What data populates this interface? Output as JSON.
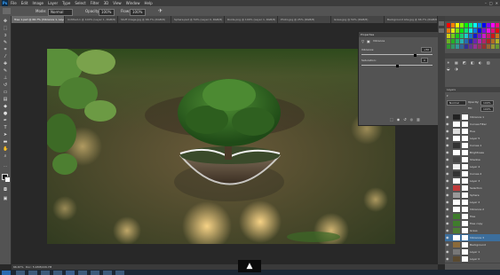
{
  "app": {
    "logo": "Ps"
  },
  "menu": [
    "File",
    "Edit",
    "Image",
    "Layer",
    "Type",
    "Select",
    "Filter",
    "3D",
    "View",
    "Window",
    "Help"
  ],
  "window_controls": [
    "–",
    "□",
    "✕"
  ],
  "options_bar": {
    "mode_label": "Mode:",
    "mode_value": "Normal",
    "opacity_label": "Opacity:",
    "opacity_value": "100%",
    "flow_label": "Flow:",
    "flow_value": "100%"
  },
  "tabs": [
    {
      "label": "Tree 1.psd @ 66.7% (Vibrance 1, Layer Mask/8) *",
      "active": true
    },
    {
      "label": "Untitled-1 @ 100% (Layer 1, RGB/8)",
      "active": false
    },
    {
      "label": "Stuff image.jpg @ 66.7% (RGB/8)",
      "active": false
    },
    {
      "label": "Sphere.psd @ 50% (Layer 0, RGB/8)",
      "active": false
    },
    {
      "label": "Roots.png @ 100% (Layer 1, RGB/8)",
      "active": false
    },
    {
      "label": "Photo.jpg @ 25% (RGB/8)",
      "active": false
    },
    {
      "label": "Grass.jpg @ 50% (RGB/8)",
      "active": false
    },
    {
      "label": "Background Lite.jpg @ 66.7% (RGB/8)",
      "active": false
    }
  ],
  "properties": {
    "title": "Properties",
    "adjustment": "Vibrance",
    "vibrance_label": "Vibrance:",
    "vibrance_value": "+50",
    "saturation_label": "Saturation:",
    "saturation_value": "0",
    "vibrance_level": 0.75,
    "saturation_level": 0.5
  },
  "layers_panel": {
    "title": "Layers",
    "blend_mode": "Normal",
    "opacity_label": "Opacity:",
    "opacity_value": "100%",
    "fill_label": "Fill:",
    "fill_value": "100%",
    "layers": [
      {
        "name": "Vibrance 1",
        "thumb": "#222222",
        "selected": false
      },
      {
        "name": "Curves Filter",
        "thumb": "#ffffff",
        "selected": false
      },
      {
        "name": "Hue",
        "thumb": "#dddddd",
        "selected": false
      },
      {
        "name": "Layer 5",
        "thumb": "#ffffff",
        "selected": false
      },
      {
        "name": "Curves 1",
        "thumb": "#333333",
        "selected": false
      },
      {
        "name": "Brightness",
        "thumb": "#ffffff",
        "selected": false
      },
      {
        "name": "Shadow",
        "thumb": "#444444",
        "selected": false
      },
      {
        "name": "Layer 4",
        "thumb": "#eeeeee",
        "selected": false
      },
      {
        "name": "Curves 2",
        "thumb": "#333333",
        "selected": false
      },
      {
        "name": "Layer 3",
        "thumb": "#ffffff",
        "selected": false
      },
      {
        "name": "Selection",
        "thumb": "#c23b3b",
        "selected": false
      },
      {
        "name": "Sphere",
        "thumb": "#999999",
        "selected": false
      },
      {
        "name": "Layer 2",
        "thumb": "#ffffff",
        "selected": false
      },
      {
        "name": "Vibrance 2",
        "thumb": "#ffffff",
        "selected": false
      },
      {
        "name": "Tree",
        "thumb": "#3f7c2c",
        "selected": false
      },
      {
        "name": "Tree copy",
        "thumb": "#3f7c2c",
        "selected": false
      },
      {
        "name": "Grass",
        "thumb": "#4c7d33",
        "selected": false
      },
      {
        "name": "Vibrance 3",
        "thumb": "#ffffff",
        "selected": true
      },
      {
        "name": "Background",
        "thumb": "#8a6a3a",
        "selected": false
      },
      {
        "name": "Layer 1",
        "thumb": "#777777",
        "selected": false
      },
      {
        "name": "Layer 0",
        "thumb": "#5a4a30",
        "selected": false
      }
    ]
  },
  "status": {
    "zoom": "66.67%",
    "doc": "Doc: 5.93M/229.7M"
  },
  "scroll_up_button": "▲"
}
